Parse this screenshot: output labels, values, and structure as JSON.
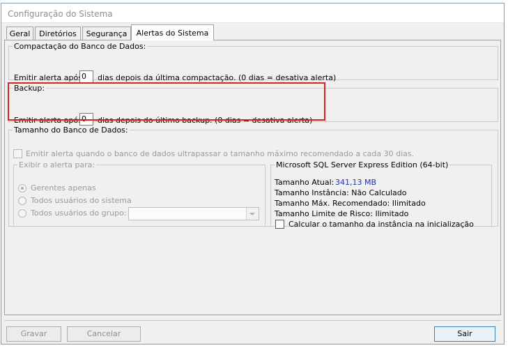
{
  "window": {
    "title": "Configuração do Sistema"
  },
  "tabs": [
    "Geral",
    "Diretórios",
    "Segurança",
    "Alertas do Sistema"
  ],
  "compactacao": {
    "legend": "Compactação do Banco de Dados:",
    "label_before": "Emitir alerta após",
    "value": "0",
    "label_after": "dias depois da última compactação. (0 dias = desativa alerta)"
  },
  "backup": {
    "legend": "Backup:",
    "label_before": "Emitir alerta após",
    "value": "0",
    "label_after": "dias depois do último backup. (0 dias = desativa alerta)"
  },
  "tamanho": {
    "legend": "Tamanho do Banco de Dados:",
    "checkbox_label": "Emitir alerta quando o banco de dados ultrapassar o tamanho máximo recomendado a cada 30 dias.",
    "exibir": {
      "legend": "Exibir o alerta para:",
      "options": [
        "Gerentes apenas",
        "Todos usuários do sistema",
        "Todos usuários do grupo:"
      ],
      "group_select_value": ""
    },
    "sql": {
      "legend": "Microsoft SQL Server Express Edition (64-bit)",
      "tamanho_atual_label": "Tamanho Atual:",
      "tamanho_atual_value": "341,13 MB",
      "instancia": "Tamanho Instância: Não Calculado",
      "maximo": "Tamanho Máx. Recomendado: Ilimitado",
      "limite": "Tamanho Limite de Risco: Ilimitado",
      "calc_checkbox": "Calcular o tamanho da instância na inicialização"
    }
  },
  "buttons": {
    "gravar": "Gravar",
    "cancelar": "Cancelar",
    "sair": "Sair"
  },
  "colors": {
    "highlight": "#e0201f",
    "value_blue": "#2234a8"
  }
}
